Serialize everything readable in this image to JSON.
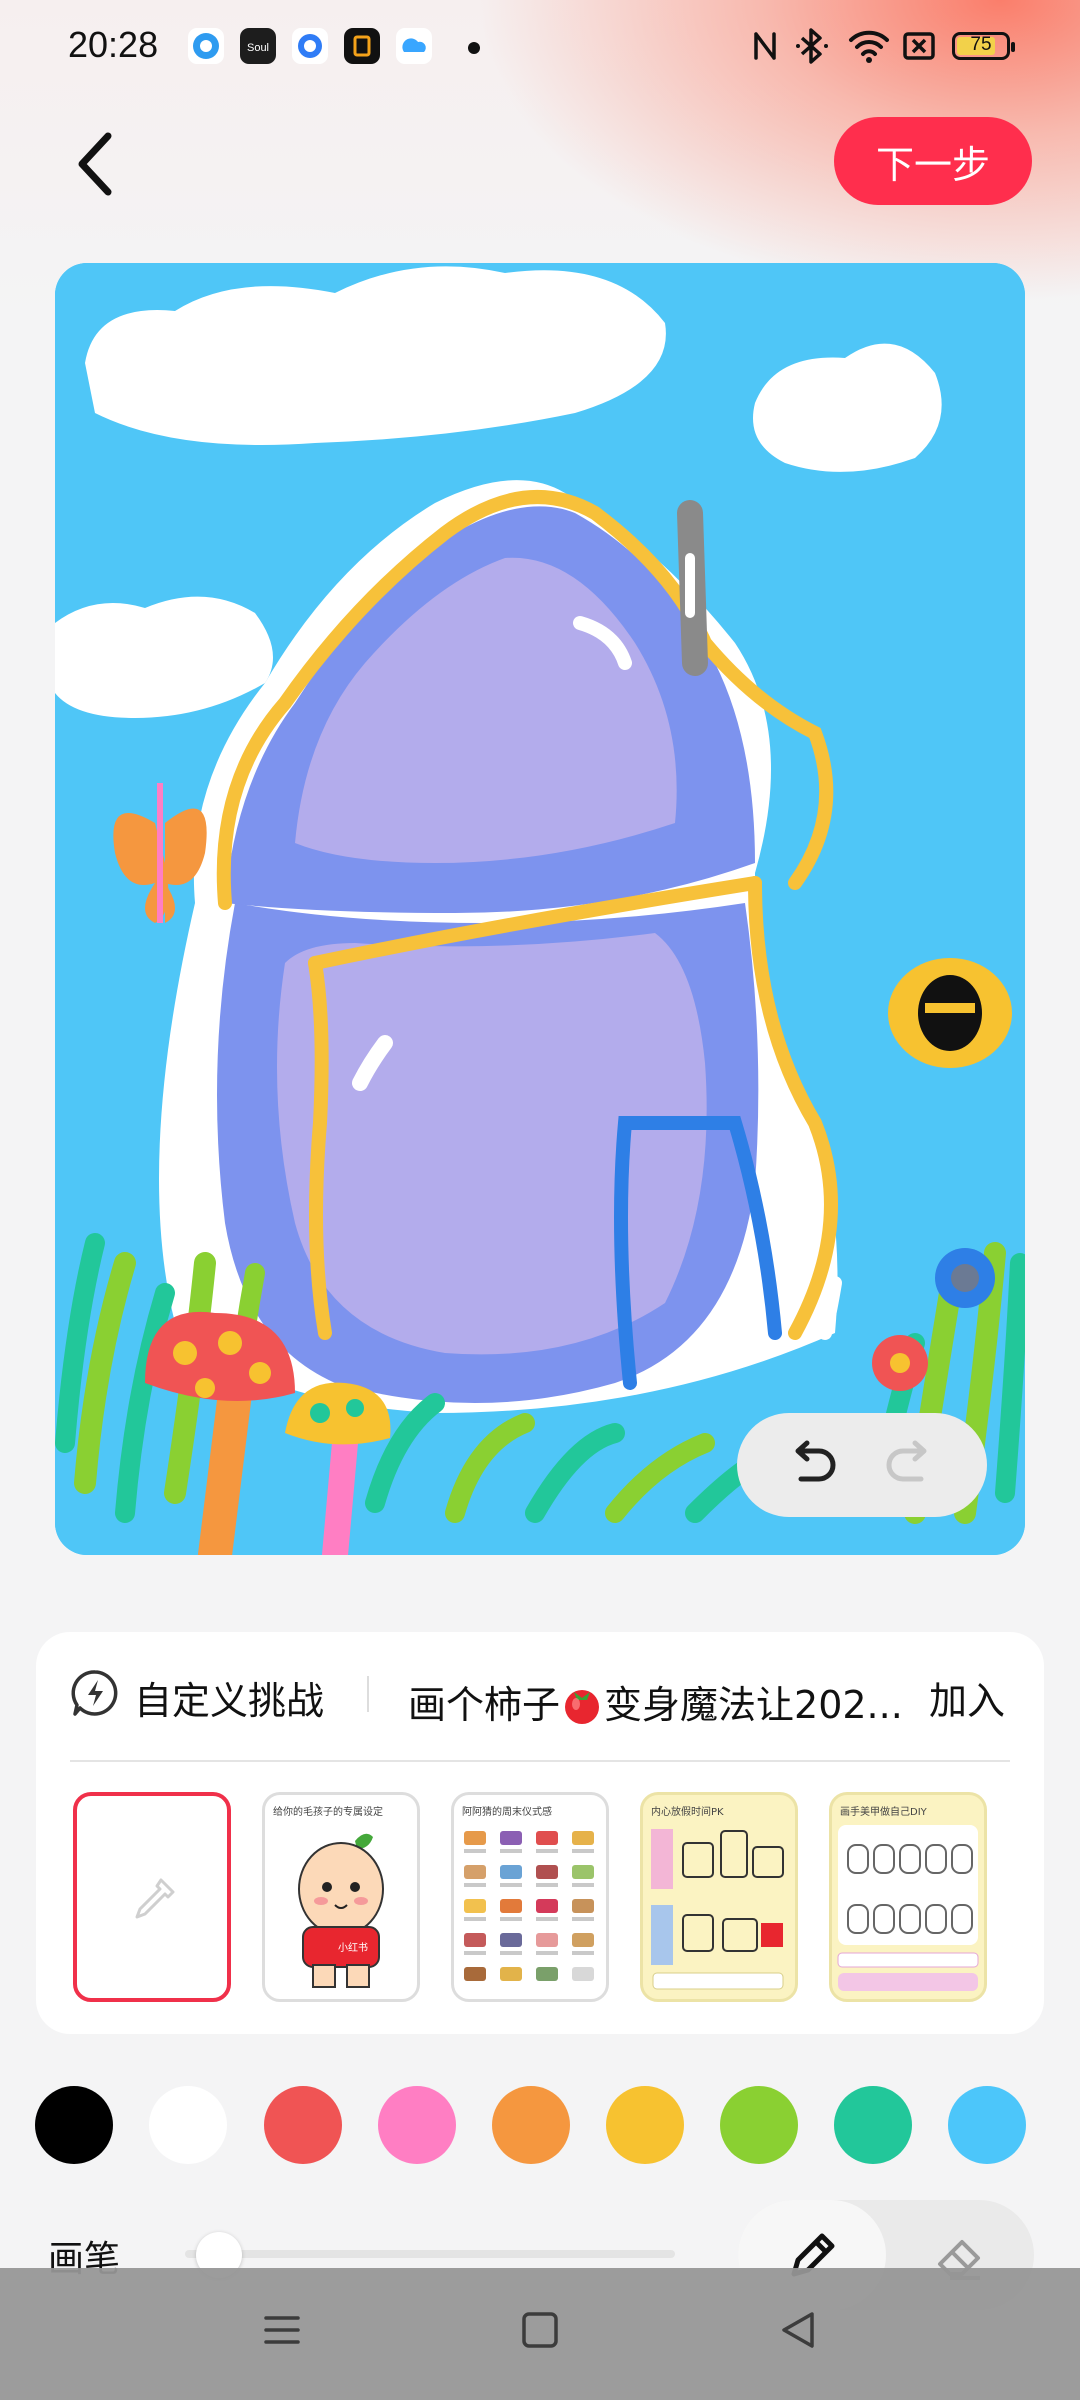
{
  "status_bar": {
    "time": "20:28",
    "notification_icons": [
      "chat-app-icon",
      "soul-app-icon",
      "browser-app-icon",
      "notes-app-icon",
      "cloud-app-icon"
    ],
    "system_icons": [
      "nfc-icon",
      "bluetooth-icon",
      "wifi-icon",
      "sim-off-icon"
    ],
    "battery_level": "75"
  },
  "header": {
    "back_icon": "chevron-left-icon",
    "next_label": "下一步"
  },
  "canvas": {
    "undo_icon": "undo-icon",
    "redo_icon": "redo-icon",
    "redo_enabled": false
  },
  "challenge": {
    "custom_label": "自定义挑战",
    "topic_text": "画个柿子",
    "topic_suffix": "变身魔法让202...",
    "join_label": "加入",
    "templates": [
      {
        "title": "",
        "selected": true,
        "theme": "blank"
      },
      {
        "title": "给你的毛孩子的专属设定",
        "selected": false,
        "theme": "white"
      },
      {
        "title": "阿阿猜的周末仪式感",
        "selected": false,
        "theme": "white"
      },
      {
        "title": "内心放假时间PK",
        "selected": false,
        "theme": "yellow"
      },
      {
        "title": "画手美甲做自己DIY",
        "selected": false,
        "theme": "yellow"
      }
    ]
  },
  "palette": {
    "colors": [
      "#000000",
      "#ffffff",
      "#f05454",
      "#ff7ec3",
      "#f5973f",
      "#f7c230",
      "#8ad032",
      "#22c79a",
      "#4cc6fa"
    ]
  },
  "brush": {
    "label": "画笔",
    "size_fraction": 0.07,
    "active_tool": "pen"
  },
  "nav_bar": {
    "icons": [
      "menu-icon",
      "home-icon",
      "back-triangle-icon"
    ]
  }
}
